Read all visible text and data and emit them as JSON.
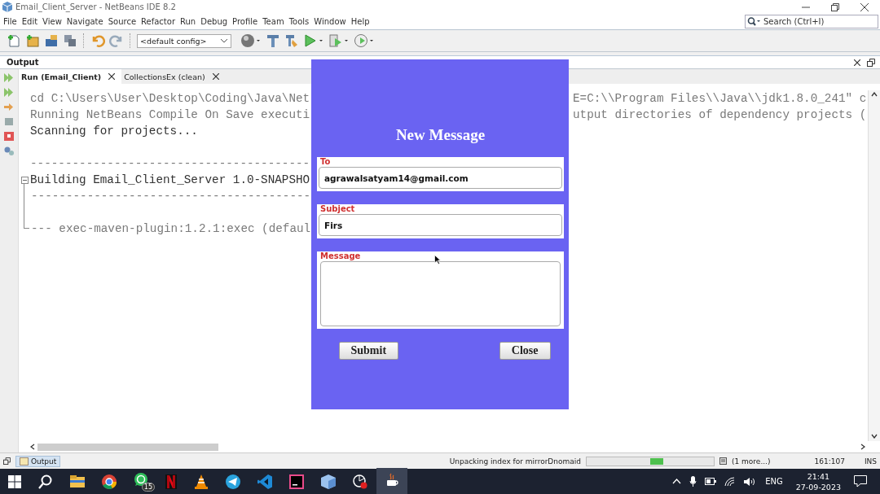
{
  "window": {
    "title": "Email_Client_Server - NetBeans IDE 8.2"
  },
  "menu": [
    "File",
    "Edit",
    "View",
    "Navigate",
    "Source",
    "Refactor",
    "Run",
    "Debug",
    "Profile",
    "Team",
    "Tools",
    "Window",
    "Help"
  ],
  "toolbar": {
    "config": "<default config>"
  },
  "search": {
    "placeholder": "Search (Ctrl+I)"
  },
  "output": {
    "title": "Output",
    "tabs": [
      {
        "label": "Run (Email_Client)",
        "selected": true
      },
      {
        "label": "CollectionsEx (clean)",
        "selected": false
      }
    ],
    "lines": [
      {
        "text": "cd C:\\Users\\User\\Desktop\\Coding\\Java\\Net",
        "kind": "muted",
        "spaced": false
      },
      {
        "text": "Running NetBeans Compile On Save executi",
        "kind": "muted",
        "spaced": false
      },
      {
        "text": "Scanning for projects...",
        "kind": "plain",
        "spaced": false
      },
      {
        "text": "----------------------------------------",
        "kind": "muted",
        "spaced": true
      },
      {
        "text": "Building Email_Client_Server 1.0-SNAPSHO",
        "kind": "plain",
        "spaced": false,
        "expanded": true,
        "children": [
          {
            "text": "----------------------------------------",
            "kind": "muted",
            "spaced": false
          },
          {
            "text": "--- exec-maven-plugin:1.2.1:exec (defaul",
            "kind": "muted",
            "spaced": true
          }
        ]
      }
    ],
    "right_lines": [
      {
        "text": "E=C:\\\\Program Files\\\\Java\\\\jdk1.8.0_241\" c",
        "kind": "muted"
      },
      {
        "text": "utput directories of dependency projects (",
        "kind": "muted"
      }
    ]
  },
  "dialog": {
    "title": "New Message",
    "fields": [
      {
        "label": "To",
        "value": "agrawalsatyam14@gmail.com",
        "kind": "line"
      },
      {
        "label": "Subject",
        "value": "Firs",
        "kind": "line"
      },
      {
        "label": "Message",
        "kind": "area"
      }
    ],
    "buttons": [
      "Submit",
      "Close"
    ]
  },
  "status_bar": {
    "output_tab": "Output",
    "task": "Unpacking index for mirrorDnomaid",
    "level": 0.6,
    "more": "(1 more...)",
    "position": "161:107",
    "mode": "INS"
  },
  "taskbar": {
    "chat_badge": "15",
    "language": "ENG",
    "time": "21:41",
    "date": "27-09-2023"
  }
}
